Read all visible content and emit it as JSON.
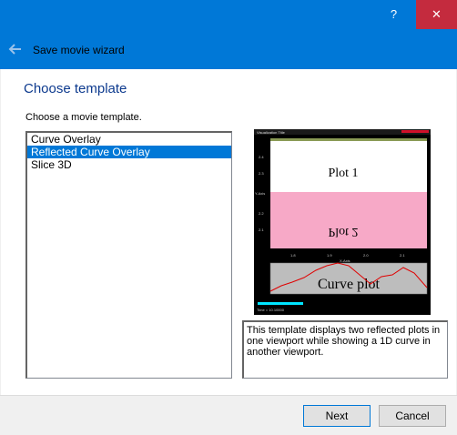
{
  "window": {
    "help_glyph": "?",
    "close_glyph": "✕",
    "wizard_title": "Save movie wizard"
  },
  "page": {
    "heading": "Choose template",
    "instruction": "Choose a movie template."
  },
  "templates": [
    {
      "label": "Curve Overlay",
      "selected": false
    },
    {
      "label": "Reflected Curve Overlay",
      "selected": true
    },
    {
      "label": "Slice 3D",
      "selected": false
    }
  ],
  "preview": {
    "vis_title": "Visualization Title",
    "plot1": "Plot 1",
    "plot2": "Plot 2",
    "curve": "Curve plot",
    "axis_x": "X-Axis",
    "axis_y": "Y-Axis",
    "time": "Time = 10.10000",
    "yticks": [
      "2.4",
      "2.3",
      "2.2",
      "2.1"
    ],
    "xticks": [
      "1.8",
      "1.9",
      "2.0",
      "2.1"
    ],
    "accent_red": "#d0102a",
    "plot2_bg": "#f7a9c7",
    "curve_bg": "#bdbdbd"
  },
  "description": "This template displays two reflected plots in one viewport while showing a 1D curve in another viewport.",
  "buttons": {
    "next": "Next",
    "cancel": "Cancel"
  }
}
